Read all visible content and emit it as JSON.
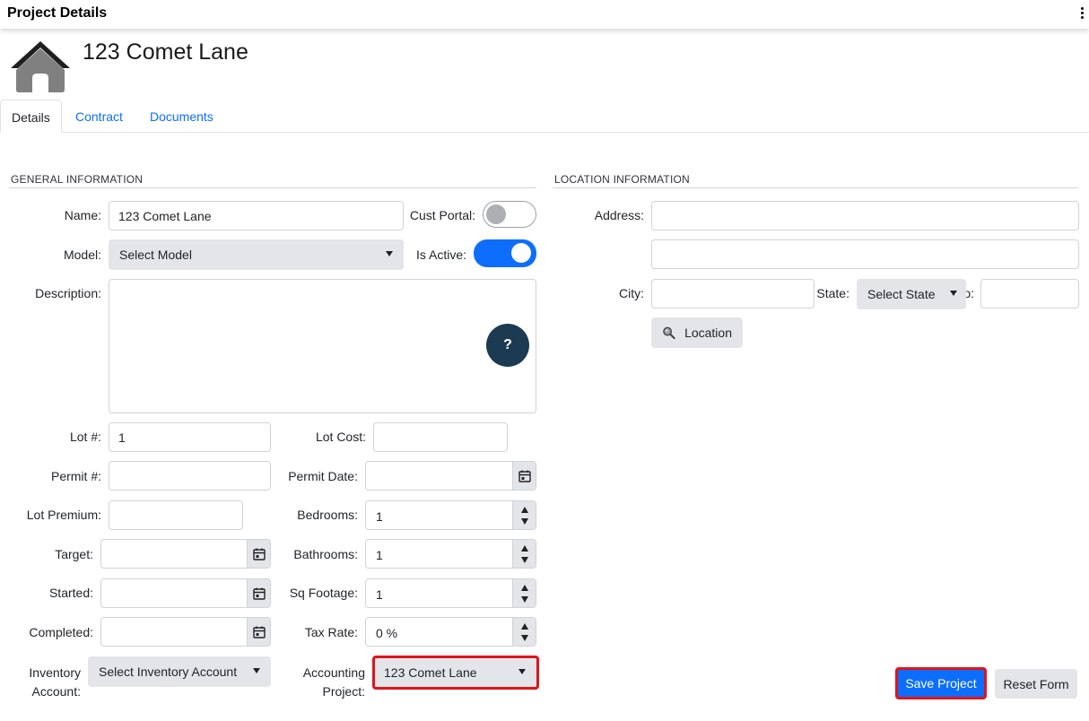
{
  "header": {
    "title": "Project Details",
    "menu_icon": "kebab-menu-icon"
  },
  "project": {
    "name": "123 Comet Lane",
    "icon": "house-icon"
  },
  "tabs": [
    {
      "label": "Details",
      "active": true
    },
    {
      "label": "Contract",
      "active": false
    },
    {
      "label": "Documents",
      "active": false
    }
  ],
  "general": {
    "section_title": "GENERAL INFORMATION",
    "name_label": "Name:",
    "name_value": "123 Comet Lane",
    "cust_portal_label": "Cust Portal:",
    "cust_portal_on": false,
    "model_label": "Model:",
    "model_value": "Select Model",
    "is_active_label": "Is Active:",
    "is_active_on": true,
    "description_label": "Description:",
    "description_value": "",
    "help_label": "?",
    "lot_label": "Lot #:",
    "lot_value": "1",
    "lot_cost_label": "Lot Cost:",
    "lot_cost_value": "",
    "permit_label": "Permit #:",
    "permit_value": "",
    "permit_date_label": "Permit Date:",
    "permit_date_value": "",
    "lot_premium_label": "Lot Premium:",
    "lot_premium_value": "",
    "bedrooms_label": "Bedrooms:",
    "bedrooms_value": "1",
    "target_label": "Target:",
    "target_value": "",
    "bathrooms_label": "Bathrooms:",
    "bathrooms_value": "1",
    "started_label": "Started:",
    "started_value": "",
    "sq_footage_label": "Sq Footage:",
    "sq_footage_value": "1",
    "completed_label": "Completed:",
    "completed_value": "",
    "tax_rate_label": "Tax Rate:",
    "tax_rate_value": "0 %",
    "inventory_label_1": "Inventory",
    "inventory_label_2": "Account:",
    "inventory_value": "Select Inventory Account",
    "accounting_label_1": "Accounting",
    "accounting_label_2": "Project:",
    "accounting_value": "123 Comet Lane"
  },
  "location": {
    "section_title": "LOCATION INFORMATION",
    "address_label": "Address:",
    "address_line1": "",
    "address_line2": "",
    "city_label": "City:",
    "city_value": "",
    "state_label": "State:",
    "state_value": "Select State",
    "zip_label_partial": "o:",
    "zip_value": "",
    "location_button": "Location"
  },
  "actions": {
    "save_label": "Save Project",
    "reset_label": "Reset Form"
  },
  "colors": {
    "primary": "#0d6efd",
    "highlight": "#e0141b",
    "help_button": "#1c3a52",
    "house_icon": "#808080"
  }
}
